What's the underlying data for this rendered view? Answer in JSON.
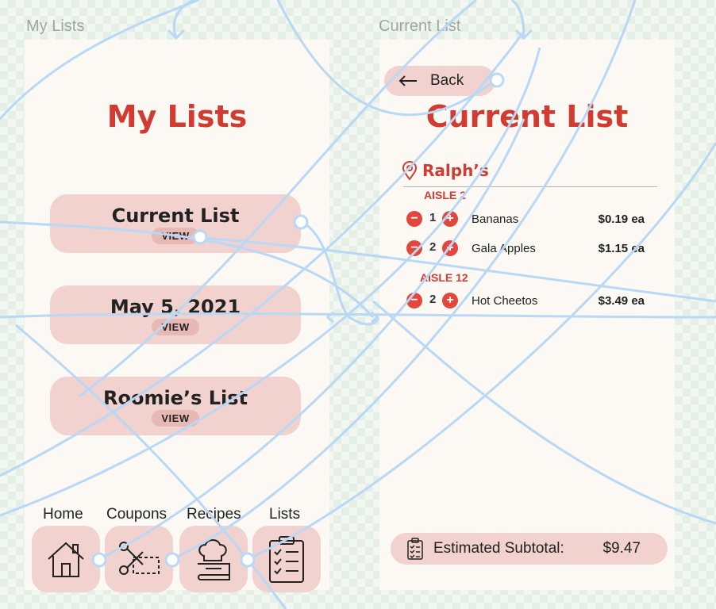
{
  "frames": {
    "my_lists_label": "My Lists",
    "current_list_label": "Current List"
  },
  "my_lists": {
    "title": "My Lists",
    "cards": [
      {
        "title": "Current List",
        "action": "VIEW"
      },
      {
        "title": "May 5, 2021",
        "action": "VIEW"
      },
      {
        "title": "Roomie’s List",
        "action": "VIEW"
      }
    ],
    "nav": [
      {
        "label": "Home",
        "icon": "home-icon"
      },
      {
        "label": "Coupons",
        "icon": "scissors-coupon-icon"
      },
      {
        "label": "Recipes",
        "icon": "chef-hat-book-icon"
      },
      {
        "label": "Lists",
        "icon": "clipboard-checklist-icon"
      }
    ]
  },
  "current_list": {
    "back_label": "Back",
    "title": "Current List",
    "store": "Ralph’s",
    "aisles": [
      {
        "label": "AISLE 2",
        "items": [
          {
            "qty": "1",
            "name": "Bananas",
            "price": "$0.19 ea"
          },
          {
            "qty": "2",
            "name": "Gala Apples",
            "price": "$1.15 ea"
          }
        ]
      },
      {
        "label": "AISLE 12",
        "items": [
          {
            "qty": "2",
            "name": "Hot Cheetos",
            "price": "$3.49 ea"
          }
        ]
      }
    ],
    "subtotal_label": "Estimated Subtotal:",
    "subtotal_value": "$9.47"
  },
  "colors": {
    "accent": "#d23b32",
    "card": "#f2d2cf",
    "connector": "#b8d8f5"
  }
}
